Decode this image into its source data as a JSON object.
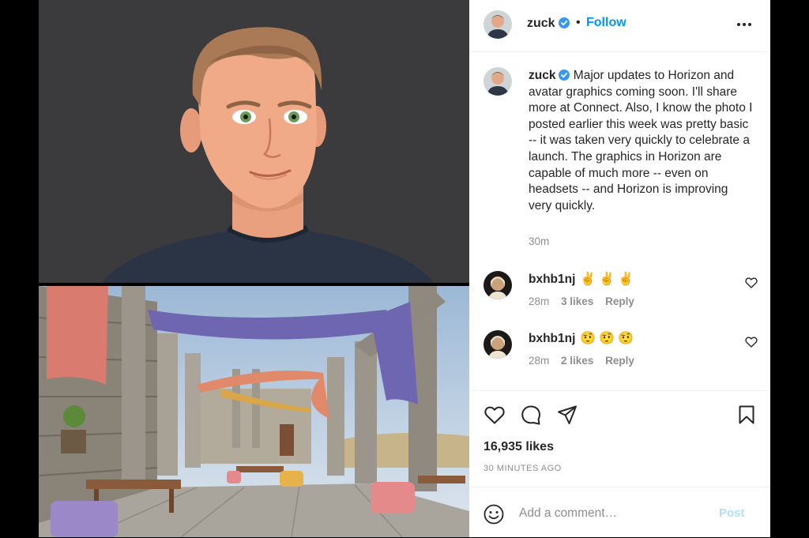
{
  "post": {
    "username": "zuck",
    "follow_label": "Follow",
    "dot": "•",
    "caption": "Major updates to Horizon and avatar graphics coming soon. I'll share more at Connect. Also, I know the photo I posted earlier this week was pretty basic -- it was taken very quickly to celebrate a launch. The graphics in Horizon are capable of much more -- even on headsets -- and Horizon is improving very quickly.",
    "caption_time": "30m",
    "likes": "16,935 likes",
    "time_ago": "30 MINUTES AGO"
  },
  "comments": [
    {
      "username": "bxhb1nj",
      "text": "✌✌✌",
      "time": "28m",
      "likes": "3 likes",
      "reply": "Reply"
    },
    {
      "username": "bxhb1nj",
      "text": "🤨🤨🤨",
      "time": "28m",
      "likes": "2 likes",
      "reply": "Reply"
    }
  ],
  "add_comment": {
    "placeholder": "Add a comment…",
    "post_label": "Post"
  },
  "icons": {
    "verified": "verified-badge-icon",
    "more": "more-options-icon",
    "like": "heart-icon",
    "comment": "comment-icon",
    "share": "share-icon",
    "save": "bookmark-icon",
    "emoji": "emoji-icon"
  },
  "colors": {
    "accent": "#0095f6",
    "verified": "#3897f0",
    "muted": "#8e8e8e",
    "text": "#262626",
    "post_disabled": "#b2dffc"
  }
}
